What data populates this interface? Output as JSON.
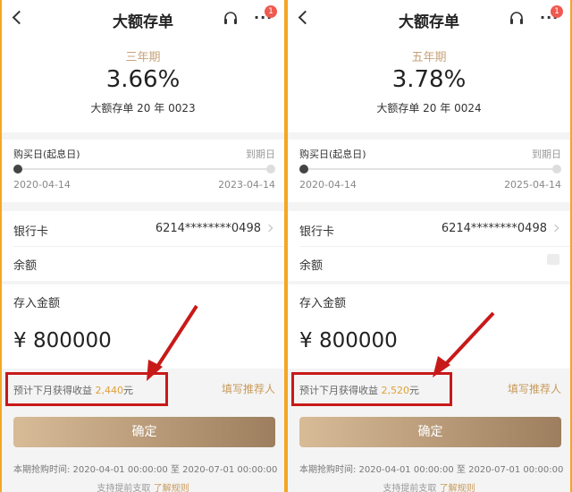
{
  "screens": [
    {
      "header": {
        "title": "大额存单",
        "badge": "1"
      },
      "rate_card": {
        "term": "三年期",
        "rate": "3.66%",
        "product": "大额存单 20 年 0023"
      },
      "timeline": {
        "start_label": "购买日(起息日)",
        "end_label": "到期日",
        "start_date": "2020-04-14",
        "end_date": "2023-04-14"
      },
      "account": {
        "card_label": "银行卡",
        "card_number": "6214********0498",
        "balance_label": "余额"
      },
      "deposit": {
        "label": "存入金额",
        "currency": "¥",
        "value": "800000"
      },
      "income": {
        "text": "预计下月获得收益",
        "value": "2,440",
        "unit": "元",
        "referrer": "填写推荐人"
      },
      "confirm_label": "确定",
      "period_text": "本期抢购时间: 2020-04-01 00:00:00 至 2020-07-01 00:00:00",
      "footer": {
        "text": "支持提前支取",
        "rules_link": "了解规则"
      }
    },
    {
      "header": {
        "title": "大额存单",
        "badge": "1"
      },
      "rate_card": {
        "term": "五年期",
        "rate": "3.78%",
        "product": "大额存单 20 年 0024"
      },
      "timeline": {
        "start_label": "购买日(起息日)",
        "end_label": "到期日",
        "start_date": "2020-04-14",
        "end_date": "2025-04-14"
      },
      "account": {
        "card_label": "银行卡",
        "card_number": "6214********0498",
        "balance_label": "余额"
      },
      "deposit": {
        "label": "存入金额",
        "currency": "¥",
        "value": "800000"
      },
      "income": {
        "text": "预计下月获得收益",
        "value": "2,520",
        "unit": "元",
        "referrer": "填写推荐人"
      },
      "confirm_label": "确定",
      "period_text": "本期抢购时间: 2020-04-01 00:00:00 至 2020-07-01 00:00:00",
      "footer": {
        "text": "支持提前支取",
        "rules_link": "了解规则"
      }
    }
  ],
  "colors": {
    "frame": "#f5a623",
    "accent_gold": "#c8a27a",
    "income_highlight": "#e0a03a",
    "annotation_red": "#c81919"
  },
  "icons": [
    "back-icon",
    "headset-icon",
    "more-icon",
    "chevron-right-icon",
    "eye-icon"
  ]
}
